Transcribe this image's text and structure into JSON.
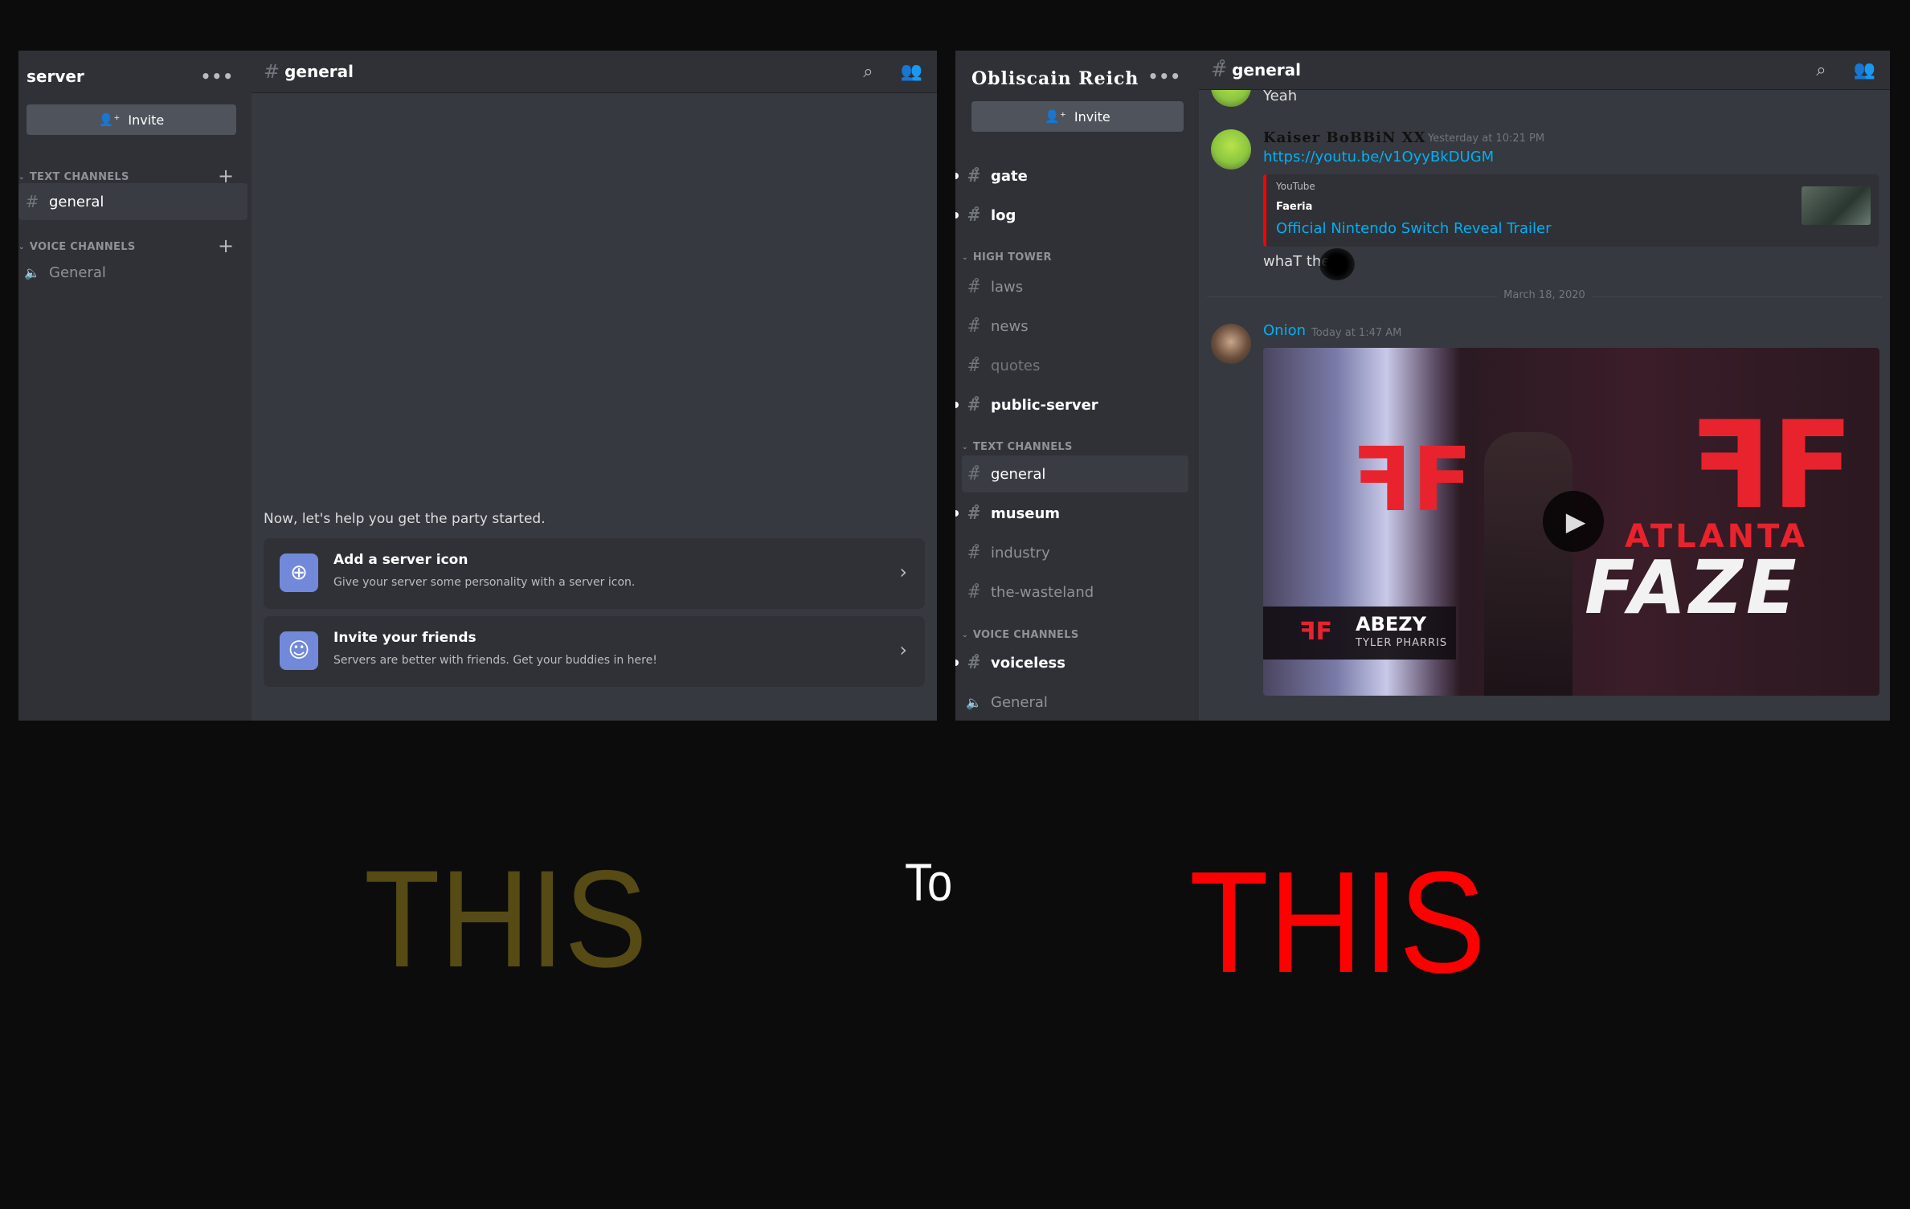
{
  "left_panel": {
    "server_name": "server",
    "menu_icon": "more-dots-icon",
    "invite_label": "Invite",
    "categories": {
      "text": "TEXT CHANNELS",
      "voice": "VOICE CHANNELS"
    },
    "text_channels": [
      {
        "name": "general",
        "active": true
      }
    ],
    "voice_channels": [
      {
        "name": "General"
      }
    ],
    "header": {
      "channel": "general",
      "hash": "#"
    },
    "welcome": {
      "prompt": "Now, let's help you get the party started.",
      "cards": [
        {
          "title": "Add a server icon",
          "subtitle": "Give your server some personality with a server icon.",
          "icon": "⊕"
        },
        {
          "title": "Invite your friends",
          "subtitle": "Servers are better with friends. Get your buddies in here!",
          "icon": "☺"
        }
      ]
    }
  },
  "right_panel": {
    "server_name": "Obliscain Reich",
    "invite_label": "Invite",
    "channels_top": [
      {
        "name": "gate",
        "unread": true
      },
      {
        "name": "log",
        "unread": true
      }
    ],
    "categories": {
      "high_tower": "HIGH TOWER",
      "text": "TEXT CHANNELS",
      "voice": "VOICE CHANNELS"
    },
    "high_tower": [
      {
        "name": "laws"
      },
      {
        "name": "news"
      },
      {
        "name": "quotes"
      },
      {
        "name": "public-server",
        "unread": true
      }
    ],
    "text_channels": [
      {
        "name": "general",
        "active": true
      },
      {
        "name": "museum",
        "unread": true
      },
      {
        "name": "industry"
      },
      {
        "name": "the-wasteland"
      }
    ],
    "voice_channels": [
      {
        "name": "voiceless",
        "unread": true
      },
      {
        "name": "General"
      }
    ],
    "header": {
      "channel": "general"
    },
    "messages": {
      "prev_text": "Yeah",
      "kaiser": {
        "author": "Kaiser BoBBiN XX",
        "timestamp": "Yesterday at 10:21 PM",
        "link": "https://youtu.be/v1OyyBkDUGM",
        "embed": {
          "provider": "YouTube",
          "author": "Faeria",
          "title": "Official Nintendo Switch Reveal Trailer"
        },
        "followup": "whaT the"
      },
      "date_divider": "March 18, 2020",
      "onion": {
        "author": "Onion",
        "timestamp": "Today at 1:47 AM",
        "video": {
          "brand_top": "ATLANTA",
          "brand_main": "FAZE",
          "player_tag": "ABEZY",
          "player_name": "TYLER PHARRIS",
          "play_icon": "▶"
        }
      }
    }
  },
  "caption": {
    "left": "THIS",
    "middle": "To",
    "right": "THIS",
    "colors": {
      "left": "#564a15",
      "middle": "#ffffff",
      "right": "#ff0000"
    }
  }
}
